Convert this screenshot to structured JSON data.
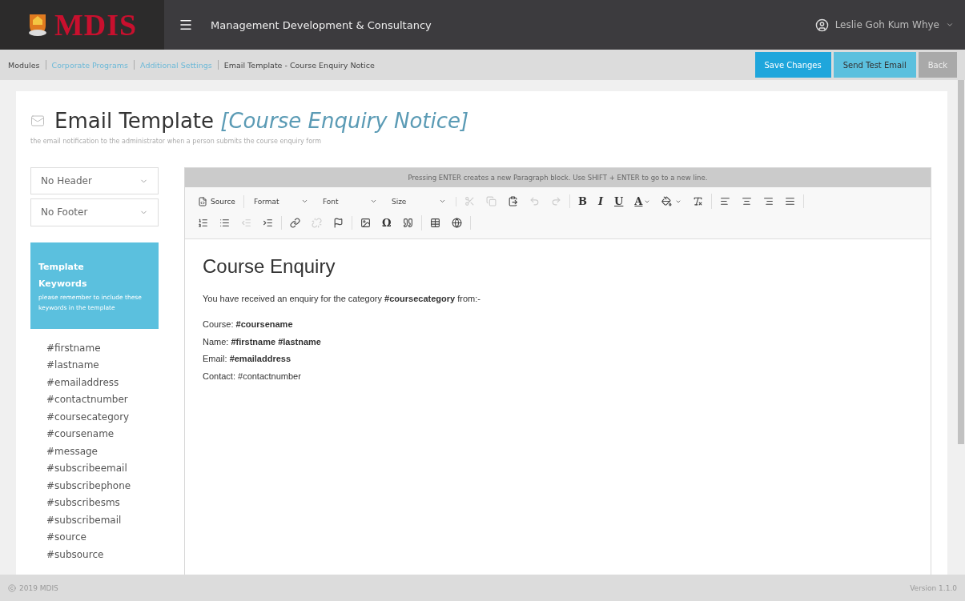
{
  "header": {
    "logo_text": "MDIS",
    "title": "Management Development & Consultancy",
    "user": "Leslie Goh Kum Whye"
  },
  "breadcrumb": [
    {
      "label": "Modules",
      "link": false
    },
    {
      "label": "Corporate Programs",
      "link": true
    },
    {
      "label": "Additional Settings",
      "link": true
    },
    {
      "label": "Email Template - Course Enquiry Notice",
      "link": false
    }
  ],
  "actions": [
    {
      "label": "Save Changes"
    },
    {
      "label": "Send Test Email"
    },
    {
      "label": "Back"
    }
  ],
  "page": {
    "title": "Email Template",
    "subtitle": "[Course Enquiry Notice]",
    "description": "the email notification to the administrator when a person submits the course enquiry form"
  },
  "selects": [
    {
      "value": "No Header"
    },
    {
      "value": "No Footer"
    }
  ],
  "keywords_panel": {
    "title": "Template Keywords",
    "note": "please remember to include these keywords in the template"
  },
  "keywords": [
    "#firstname",
    "#lastname",
    "#emailaddress",
    "#contactnumber",
    "#coursecategory",
    "#coursename",
    "#message",
    "#subscribeemail",
    "#subscribephone",
    "#subscribesms",
    "#subscribemail",
    "#source",
    "#subsource"
  ],
  "editor": {
    "notice": "Pressing ENTER creates a new Paragraph block. Use SHIFT + ENTER to go to a new line.",
    "toolbar": [
      [
        [
          {
            "kind": "button",
            "label": "Source",
            "disabled": false
          }
        ],
        [
          {
            "kind": "combo",
            "label": "Format",
            "disabled": false
          },
          {
            "kind": "combo",
            "label": "Font",
            "disabled": false
          },
          {
            "kind": "combo",
            "label": "Size",
            "disabled": false
          }
        ],
        [
          {
            "kind": "icon",
            "disabled": true
          },
          {
            "kind": "icon",
            "disabled": true
          },
          {
            "kind": "icon",
            "disabled": false
          },
          {
            "kind": "icon",
            "disabled": true
          },
          {
            "kind": "icon",
            "disabled": true
          }
        ],
        [
          {
            "kind": "glyph",
            "label": "B",
            "disabled": false
          },
          {
            "kind": "glyph",
            "label": "I",
            "disabled": false
          },
          {
            "kind": "glyph",
            "label": "U",
            "disabled": false
          },
          {
            "kind": "glyph-caret",
            "label": "A",
            "disabled": false
          },
          {
            "kind": "icon-caret",
            "disabled": false
          },
          {
            "kind": "icon",
            "disabled": false
          }
        ],
        [
          {
            "kind": "icon",
            "disabled": false
          },
          {
            "kind": "icon",
            "disabled": false
          },
          {
            "kind": "icon",
            "disabled": false
          },
          {
            "kind": "icon",
            "disabled": false
          }
        ]
      ],
      [
        [
          {
            "kind": "icon",
            "disabled": false
          },
          {
            "kind": "icon",
            "disabled": false
          },
          {
            "kind": "icon",
            "disabled": true
          },
          {
            "kind": "icon",
            "disabled": false
          }
        ],
        [
          {
            "kind": "icon",
            "disabled": false
          },
          {
            "kind": "icon",
            "disabled": true
          },
          {
            "kind": "icon",
            "disabled": false
          }
        ],
        [
          {
            "kind": "icon",
            "disabled": false
          },
          {
            "kind": "glyph",
            "label": "Ω",
            "disabled": false
          },
          {
            "kind": "icon",
            "disabled": false
          }
        ],
        [
          {
            "kind": "icon",
            "disabled": false
          },
          {
            "kind": "icon",
            "disabled": false
          }
        ]
      ]
    ],
    "content": {
      "heading": "Course Enquiry",
      "intro": "You have received an enquiry for the category **#coursecategory** from:-",
      "lines": [
        "Course: **#coursename**",
        "Name: **#firstname #lastname**",
        "Email: **#emailaddress**",
        "Contact: #contactnumber"
      ]
    }
  },
  "footer": {
    "copyright": "2019 MDIS",
    "version": "Version 1.1.0"
  }
}
